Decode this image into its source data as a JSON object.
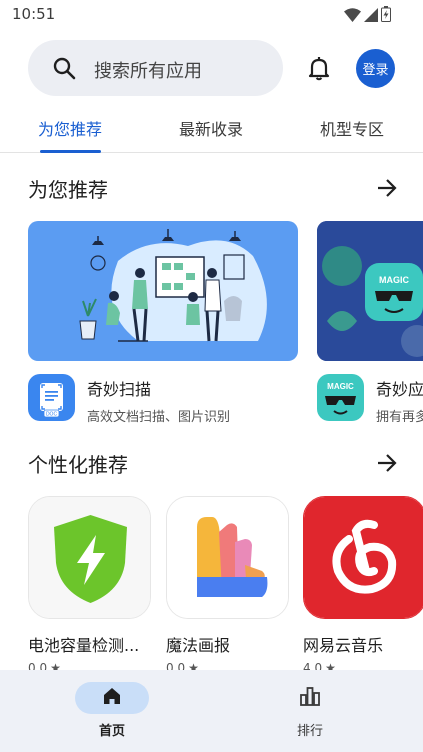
{
  "status_bar": {
    "time": "10:51"
  },
  "search": {
    "placeholder": "搜索所有应用"
  },
  "header": {
    "login_label": "登录"
  },
  "tabs": [
    {
      "label": "为您推荐",
      "active": true
    },
    {
      "label": "最新收录",
      "active": false
    },
    {
      "label": "机型专区",
      "active": false
    }
  ],
  "sections": {
    "recommended": {
      "title": "为您推荐"
    },
    "personalized": {
      "title": "个性化推荐"
    }
  },
  "featured_apps": [
    {
      "name": "奇妙扫描",
      "desc": "高效文档扫描、图片识别",
      "icon_text": "DOC"
    },
    {
      "name": "奇妙应用",
      "desc": "拥有再多",
      "icon_text": "MAGIC"
    }
  ],
  "personalized_apps": [
    {
      "name": "电池容量检测...",
      "rating": "0.0"
    },
    {
      "name": "魔法画报",
      "rating": "0.0"
    },
    {
      "name": "网易云音乐",
      "rating": "4.0"
    }
  ],
  "bottom_nav": [
    {
      "label": "首页",
      "active": true
    },
    {
      "label": "排行",
      "active": false
    }
  ]
}
